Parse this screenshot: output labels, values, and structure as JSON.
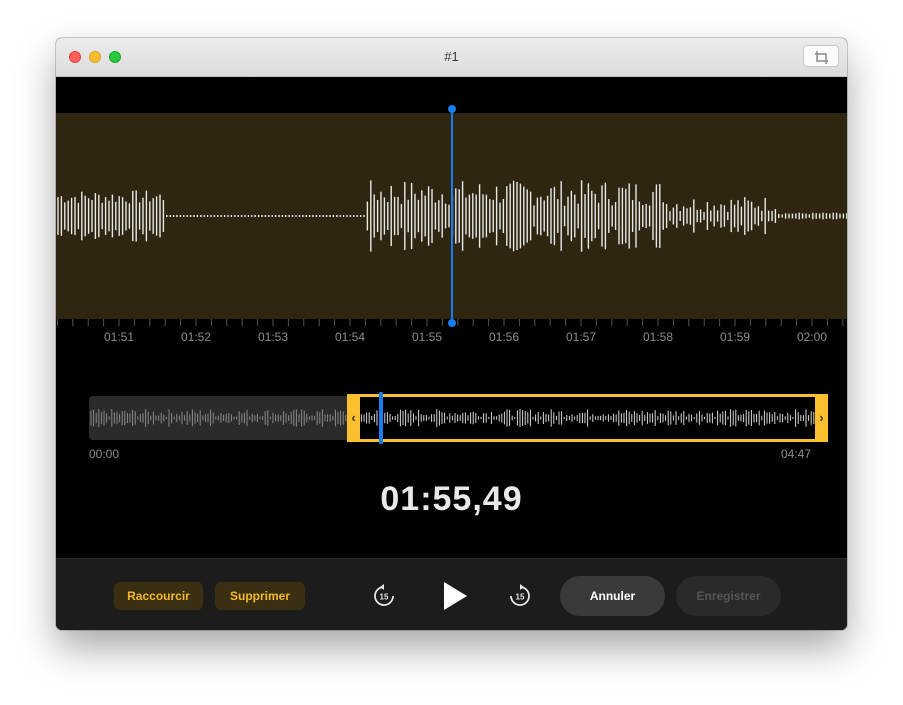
{
  "window": {
    "title": "#1"
  },
  "timeline": {
    "ticks": [
      "01:51",
      "01:52",
      "01:53",
      "01:54",
      "01:55",
      "01:56",
      "01:57",
      "01:58",
      "01:59",
      "02:00"
    ]
  },
  "overview": {
    "start": "00:00",
    "end": "04:47"
  },
  "playback": {
    "current_time": "01:55,49"
  },
  "toolbar": {
    "trim_label": "Raccourcir",
    "delete_label": "Supprimer",
    "skip_back_seconds": "15",
    "skip_forward_seconds": "15",
    "cancel_label": "Annuler",
    "save_label": "Enregistrer"
  },
  "colors": {
    "accent": "#fbc02d",
    "playhead": "#1a7cf0",
    "selection_bg": "#2e2610",
    "toolbar_text": "#f5b928"
  },
  "icons": {
    "close": "close-dot",
    "minimize": "minimize-dot",
    "zoom": "zoom-dot",
    "crop": "crop-icon",
    "skip_back": "skip-back-15-icon",
    "play": "play-icon",
    "skip_forward": "skip-forward-15-icon",
    "handle_left": "chevron-left-icon",
    "handle_right": "chevron-right-icon"
  }
}
